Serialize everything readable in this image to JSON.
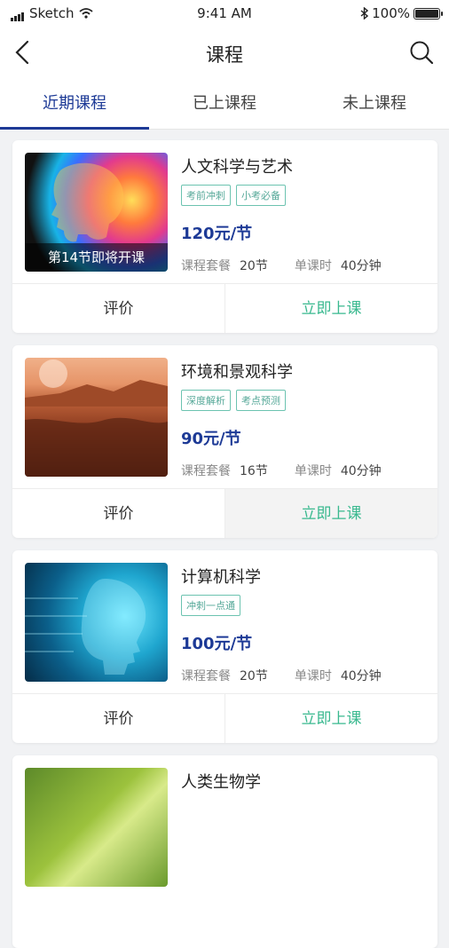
{
  "status": {
    "carrier": "Sketch",
    "time": "9:41 AM",
    "battery": "100%"
  },
  "nav": {
    "title": "课程",
    "back_icon": "back-chevron-icon",
    "search_icon": "search-icon"
  },
  "tabs": [
    {
      "label": "近期课程",
      "active": true
    },
    {
      "label": "已上课程",
      "active": false
    },
    {
      "label": "未上课程",
      "active": false
    }
  ],
  "courses": [
    {
      "title": "人文科学与艺术",
      "tags": [
        "考前冲刺",
        "小考必备"
      ],
      "price": "120元/节",
      "package_label": "课程套餐",
      "package_value": "20节",
      "duration_label": "单课时",
      "duration_value": "40分钟",
      "caption": "第14节即将开课",
      "review_label": "评价",
      "start_label": "立即上课"
    },
    {
      "title": "环境和景观科学",
      "tags": [
        "深度解析",
        "考点预测"
      ],
      "price": "90元/节",
      "package_label": "课程套餐",
      "package_value": "16节",
      "duration_label": "单课时",
      "duration_value": "40分钟",
      "review_label": "评价",
      "start_label": "立即上课"
    },
    {
      "title": "计算机科学",
      "tags": [
        "冲刺一点通"
      ],
      "price": "100元/节",
      "package_label": "课程套餐",
      "package_value": "20节",
      "duration_label": "单课时",
      "duration_value": "40分钟",
      "review_label": "评价",
      "start_label": "立即上课"
    },
    {
      "title": "人类生物学"
    }
  ],
  "colors": {
    "accent": "#1d3a96",
    "start_button": "#3ab98f",
    "tag_border": "#6cc3b0"
  }
}
